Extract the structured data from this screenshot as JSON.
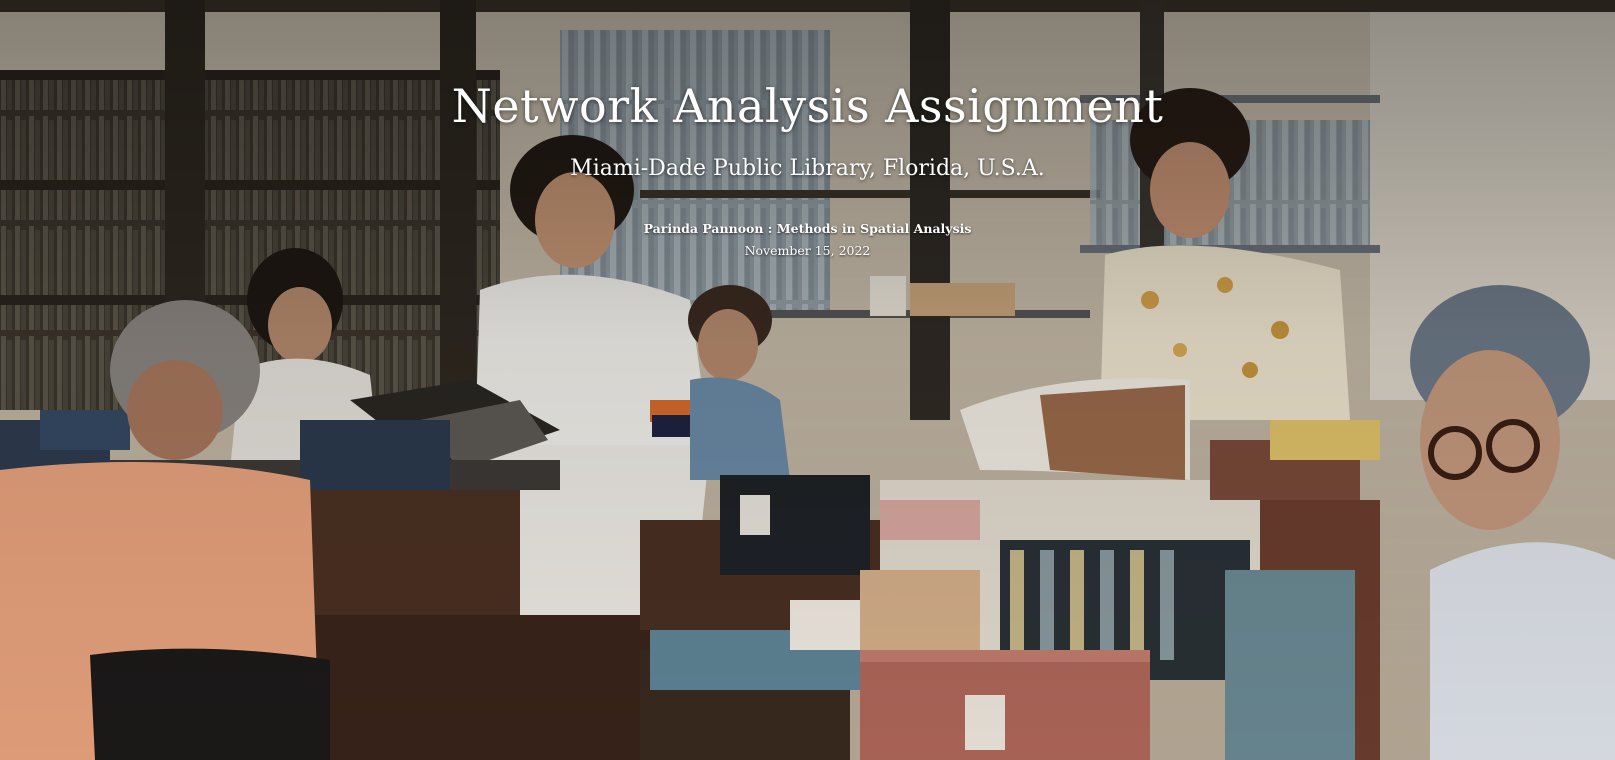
{
  "cover": {
    "title": "Network Analysis Assignment",
    "subtitle": "Miami-Dade Public Library, Florida, U.S.A.",
    "byline": "Parinda Pannoon : Methods in Spatial Analysis",
    "date": "November 15, 2022"
  },
  "background": {
    "photo_subject": "library-staff-photo",
    "colors": {
      "wall": "#d8d0c2",
      "shelf_dark": "#3a3329",
      "desk": "#4a2f22",
      "text": "#ffffff"
    }
  }
}
